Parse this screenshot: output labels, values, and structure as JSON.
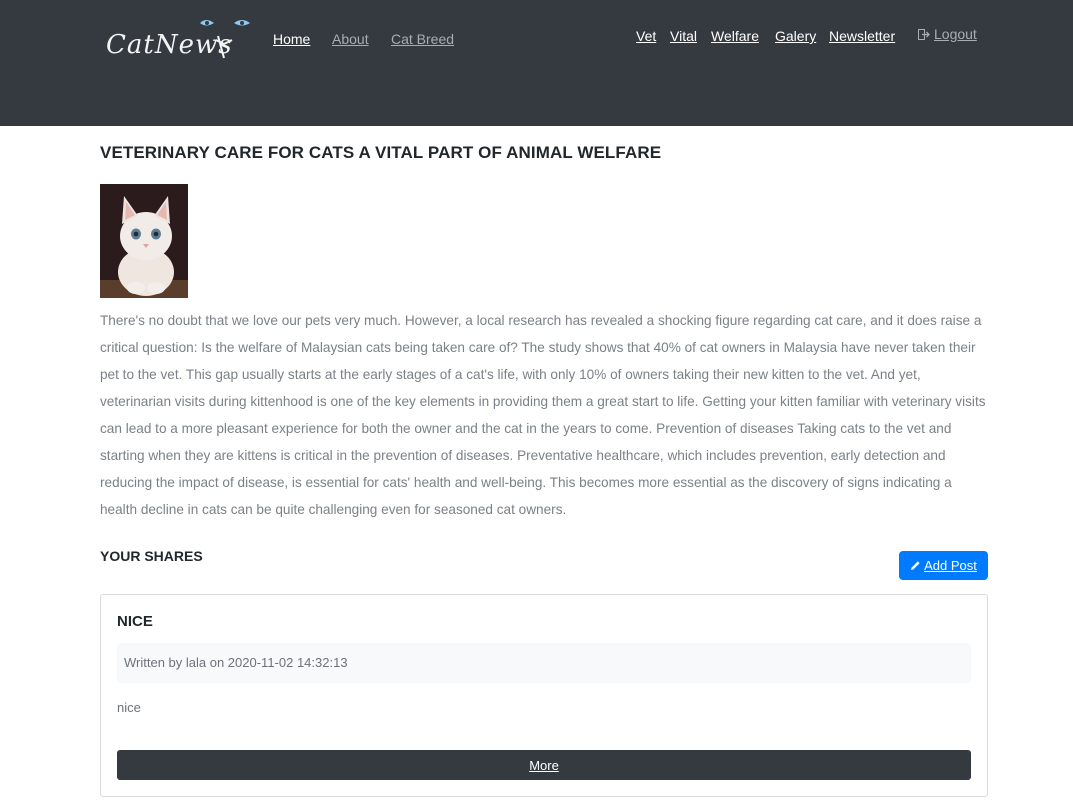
{
  "brand": {
    "name": "CatNews"
  },
  "nav_left": [
    {
      "label": "Home"
    },
    {
      "label": "About"
    },
    {
      "label": "Cat Breed"
    }
  ],
  "nav_right": [
    {
      "label": "Vet"
    },
    {
      "label": "Vital"
    },
    {
      "label": "Welfare"
    },
    {
      "label": "Galery"
    },
    {
      "label": "Newsletter"
    }
  ],
  "logout": {
    "label": "Logout",
    "icon": "logout-icon"
  },
  "article": {
    "title": "VETERINARY CARE FOR CATS A VITAL PART OF ANIMAL WELFARE",
    "image_alt": "kitten photo",
    "body": "There's no doubt that we love our pets very much. However, a local research has revealed a shocking figure regarding cat care, and it does raise a critical question: Is the welfare of Malaysian cats being taken care of? The study shows that 40% of cat owners in Malaysia have never taken their pet to the vet. This gap usually starts at the early stages of a cat's life, with only 10% of owners taking their new kitten to the vet. And yet, veterinarian visits during kittenhood is one of the key elements in providing them a great start to life. Getting your kitten familiar with veterinary visits can lead to a more pleasant experience for both the owner and the cat in the years to come. Prevention of diseases Taking cats to the vet and starting when they are kittens is critical in the prevention of diseases. Preventative healthcare, which includes prevention, early detection and reducing the impact of disease, is essential for cats' health and well-being. This becomes more essential as the discovery of signs indicating a health decline in cats can be quite challenging even for seasoned cat owners."
  },
  "shares": {
    "title": "YOUR SHARES",
    "add_button": "Add Post",
    "posts": [
      {
        "title": "NICE",
        "meta": "Written by lala on 2020-11-02 14:32:13",
        "body": "nice",
        "more": "More"
      }
    ]
  },
  "colors": {
    "navbar": "#343a40",
    "primary": "#007bff",
    "text_muted": "#7b8187"
  }
}
